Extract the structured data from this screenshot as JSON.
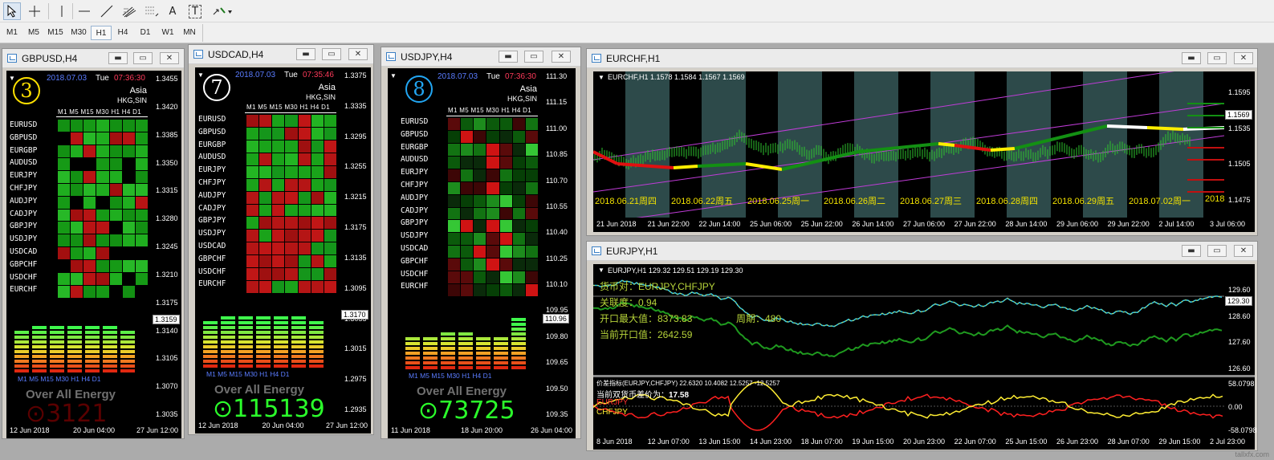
{
  "toolbar": {
    "tools": [
      "cursor-icon",
      "crosshair-icon",
      "vertical-line-icon",
      "horizontal-line-icon",
      "trendline-icon",
      "fibonacci-channel-icon",
      "fibonacci-retracement-icon",
      "text-icon",
      "text-label-icon",
      "arrows-icon"
    ],
    "periods": [
      "M1",
      "M5",
      "M15",
      "M30",
      "H1",
      "H4",
      "D1",
      "W1",
      "MN"
    ],
    "active_period": "H1",
    "text_tool": "A",
    "label_tool": "T"
  },
  "pair_list": [
    "EURUSD",
    "GBPUSD",
    "EURGBP",
    "AUDUSD",
    "EURJPY",
    "CHFJPY",
    "AUDJPY",
    "CADJPY",
    "GBPJPY",
    "USDJPY",
    "USDCAD",
    "GBPCHF",
    "USDCHF",
    "EURCHF"
  ],
  "tf_header": "M1 M5 M15 M30 H1 H4 D1",
  "tf_footer": "M1  M5  M15  M30  H1   H4   D1",
  "energy_label": "Over All Energy",
  "region": "Asia",
  "region_sub": "HKG,SIN",
  "colors": {
    "green": "#1faa1f",
    "red": "#b81414",
    "accent_blue": "#5a7cff",
    "time_red": "#ff3a5a"
  },
  "windows": [
    {
      "title": "GBPUSD,H4",
      "badge": "3",
      "badge_color": "#ffe100",
      "date": "2018.07.03",
      "day": "Tue",
      "time": "07:36:30",
      "energy": "3121",
      "energy_color": "#5a0000",
      "price_current": "1.3159",
      "yticks": [
        "1.3455",
        "1.3420",
        "1.3385",
        "1.3350",
        "1.3315",
        "1.3280",
        "1.3245",
        "1.3210",
        "1.3175",
        "1.3140",
        "1.3105",
        "1.3070",
        "1.3035"
      ],
      "xticks": [
        "12 Jun 2018",
        "20 Jun 04:00",
        "27 Jun 12:00"
      ]
    },
    {
      "title": "USDCAD,H4",
      "badge": "7",
      "badge_color": "#ffffff",
      "date": "2018.07.03",
      "day": "Tue",
      "time": "07:35:46",
      "energy": "115139",
      "energy_color": "#2bff2b",
      "price_current": "1.3170",
      "yticks": [
        "1.3375",
        "1.3335",
        "1.3295",
        "1.3255",
        "1.3215",
        "1.3175",
        "1.3135",
        "1.3095",
        "1.3055",
        "1.3015",
        "1.2975",
        "1.2935"
      ],
      "xticks": [
        "12 Jun 2018",
        "20 Jun 04:00",
        "27 Jun 12:00"
      ]
    },
    {
      "title": "USDJPY,H4",
      "badge": "8",
      "badge_color": "#22a6f2",
      "date": "2018.07.03",
      "day": "Tue",
      "time": "07:36:30",
      "energy": "73725",
      "energy_color": "#2bff2b",
      "price_current": "110.96",
      "yticks": [
        "111.30",
        "111.15",
        "111.00",
        "110.85",
        "110.70",
        "110.55",
        "110.40",
        "110.25",
        "110.10",
        "109.95",
        "109.80",
        "109.65",
        "109.50",
        "109.35"
      ],
      "xticks": [
        "11 Jun 2018",
        "18 Jun 20:00",
        "26 Jun 04:00"
      ]
    }
  ],
  "eurchf": {
    "title": "EURCHF,H1",
    "ohlc": "EURCHF,H1  1.1578 1.1584 1.1567 1.1569",
    "price_current": "1.1569",
    "yticks": [
      "1.1595",
      "1.1535",
      "1.1505",
      "1.1475"
    ],
    "xticks": [
      "21 Jun 2018",
      "21 Jun 22:00",
      "22 Jun 14:00",
      "25 Jun 06:00",
      "25 Jun 22:00",
      "26 Jun 14:00",
      "27 Jun 06:00",
      "27 Jun 22:00",
      "28 Jun 14:00",
      "29 Jun 06:00",
      "29 Jun 22:00",
      "2 Jul 14:00",
      "3 Jul 06:00"
    ],
    "day_labels": [
      "2018.06.21周四",
      "2018.06.22周五",
      "2018.06.25周一",
      "2018.06.26周二",
      "2018.06.27周三",
      "2018.06.28周四",
      "2018.06.29周五",
      "2018.07.02周一",
      "2018"
    ]
  },
  "eurjpy": {
    "title": "EURJPY,H1",
    "ohlc": "EURJPY,H1  129.32 129.51 129.19 129.30",
    "info_pair": "货币对：EURJPY,CHFJPY",
    "info_corr": "关联度：0.94",
    "info_max": "开口最大值：8373.83",
    "info_max_tail": "周期：480",
    "info_now": "当前开口值：2642.59",
    "price_current": "129.30",
    "yticks": [
      "129.60",
      "128.60",
      "127.60",
      "126.60"
    ],
    "sub_header": "价差指标(EURJPY,CHFJPY) 22.6320 10.4082 12.5257 -12.5257",
    "sub_diff": "当前双货币差价为：",
    "sub_diff_val": "17.58",
    "sub_leg1": "EURJPY",
    "sub_leg2": "CHFJPY",
    "sub_yticks": [
      "58.0798",
      "0.00",
      "-58.0798"
    ],
    "xticks": [
      "8 Jun 2018",
      "12 Jun 07:00",
      "13 Jun 15:00",
      "14 Jun 23:00",
      "18 Jun 07:00",
      "19 Jun 15:00",
      "20 Jun 23:00",
      "22 Jun 07:00",
      "25 Jun 15:00",
      "26 Jun 23:00",
      "28 Jun 07:00",
      "29 Jun 15:00",
      "2 Jul 23:00"
    ]
  },
  "watermark": "tallxfx.com"
}
